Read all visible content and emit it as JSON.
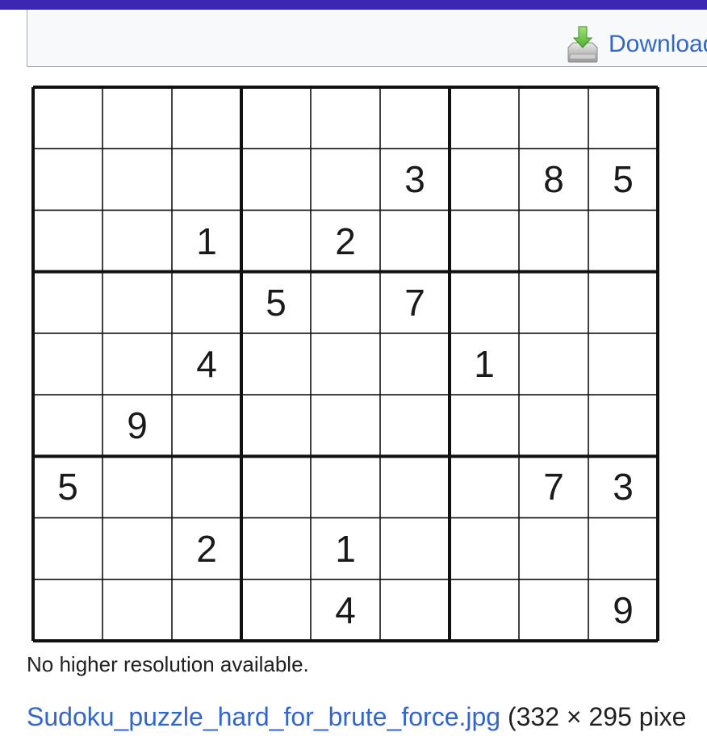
{
  "download": {
    "label": "Download",
    "icon": "download-icon"
  },
  "sudoku": {
    "cells": [
      [
        null,
        null,
        null,
        null,
        null,
        null,
        null,
        null,
        null
      ],
      [
        null,
        null,
        null,
        null,
        null,
        3,
        null,
        8,
        5
      ],
      [
        null,
        null,
        1,
        null,
        2,
        null,
        null,
        null,
        null
      ],
      [
        null,
        null,
        null,
        5,
        null,
        7,
        null,
        null,
        null
      ],
      [
        null,
        null,
        4,
        null,
        null,
        null,
        1,
        null,
        null
      ],
      [
        null,
        9,
        null,
        null,
        null,
        null,
        null,
        null,
        null
      ],
      [
        5,
        null,
        null,
        null,
        null,
        null,
        null,
        7,
        3
      ],
      [
        null,
        null,
        2,
        null,
        1,
        null,
        null,
        null,
        null
      ],
      [
        null,
        null,
        null,
        null,
        4,
        null,
        null,
        null,
        9
      ]
    ]
  },
  "resolution_note": "No higher resolution available.",
  "file": {
    "name": "Sudoku_puzzle_hard_for_brute_force.jpg",
    "info": " (332 × 295 pixe"
  },
  "colors": {
    "topbar": "#3b27b3",
    "link": "#3366cc",
    "panel": "#f8f9fa"
  }
}
